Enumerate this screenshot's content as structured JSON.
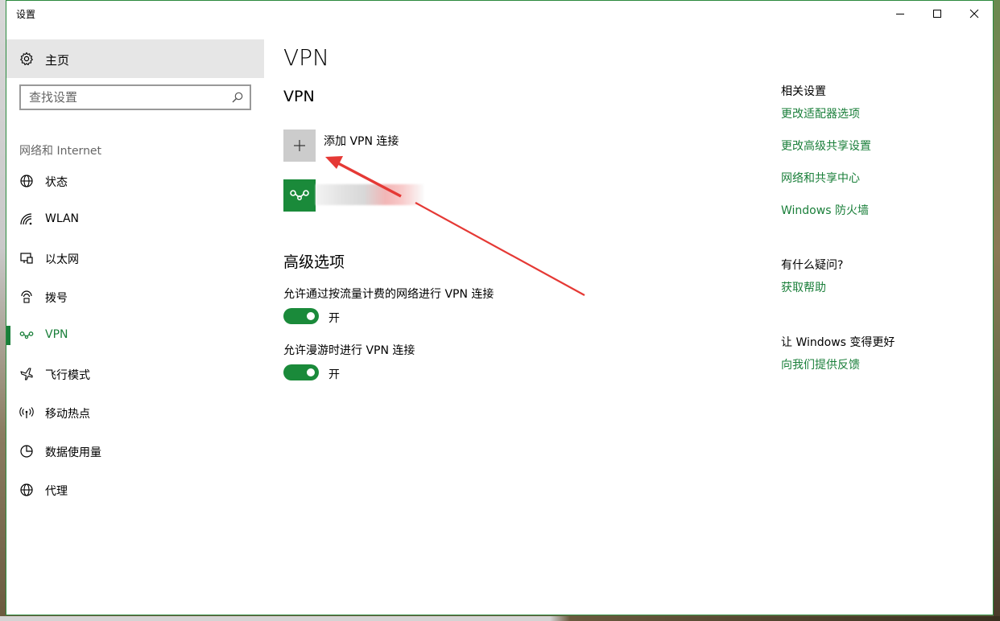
{
  "window": {
    "title": "设置"
  },
  "titlebar": {
    "minimize": "minimize-icon",
    "maximize": "maximize-icon",
    "close": "close-icon"
  },
  "sidebar": {
    "home_label": "主页",
    "search_placeholder": "查找设置",
    "section_label": "网络和 Internet",
    "items": [
      {
        "label": "状态",
        "icon": "globe-status-icon"
      },
      {
        "label": "WLAN",
        "icon": "wifi-icon"
      },
      {
        "label": "以太网",
        "icon": "ethernet-icon"
      },
      {
        "label": "拨号",
        "icon": "dialup-icon"
      },
      {
        "label": "VPN",
        "icon": "vpn-icon",
        "active": true
      },
      {
        "label": "飞行模式",
        "icon": "airplane-icon"
      },
      {
        "label": "移动热点",
        "icon": "hotspot-icon"
      },
      {
        "label": "数据使用量",
        "icon": "data-usage-icon"
      },
      {
        "label": "代理",
        "icon": "globe-icon"
      }
    ]
  },
  "main": {
    "page_title": "VPN",
    "vpn_heading": "VPN",
    "add_vpn_label": "添加 VPN 连接",
    "advanced_heading": "高级选项",
    "options": [
      {
        "label": "允许通过按流量计费的网络进行 VPN 连接",
        "state": "开",
        "on": true
      },
      {
        "label": "允许漫游时进行 VPN 连接",
        "state": "开",
        "on": true
      }
    ]
  },
  "related": {
    "heading": "相关设置",
    "links": [
      "更改适配器选项",
      "更改高级共享设置",
      "网络和共享中心",
      "Windows 防火墙"
    ],
    "question_heading": "有什么疑问?",
    "help_link": "获取帮助",
    "improve_heading": "让 Windows 变得更好",
    "feedback_link": "向我们提供反馈"
  },
  "colors": {
    "accent": "#1a7f3a",
    "toggle_on": "#1a8a3a",
    "arrow": "#e53935"
  }
}
